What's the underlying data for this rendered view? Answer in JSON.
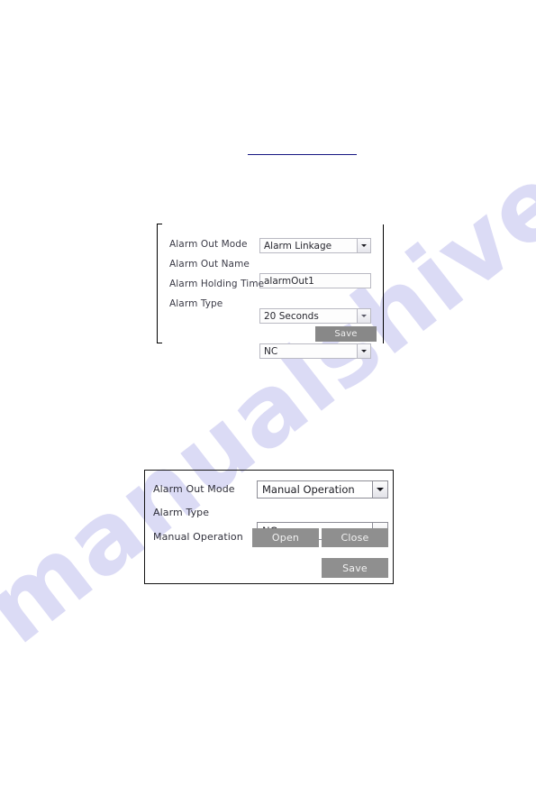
{
  "document": {
    "watermark_text": "manualshive.com",
    "watermark_color": "#c9c8f0",
    "background_color": "#ffffff",
    "rule_color": "#171782"
  },
  "panel_alarm_linkage": {
    "rows": [
      {
        "label": "Alarm Out Mode",
        "value": "Alarm Linkage",
        "control": "select",
        "icon": "chevron-down-icon"
      },
      {
        "label": "Alarm Out Name",
        "value": "alarmOut1",
        "control": "text",
        "icon": ""
      },
      {
        "label": "Alarm Holding Time",
        "value": "20 Seconds",
        "control": "select",
        "icon": "chevron-down-icon"
      },
      {
        "label": "Alarm Type",
        "value": "NC",
        "control": "select",
        "icon": "chevron-down-icon"
      }
    ],
    "save_label": "Save"
  },
  "panel_manual_operation": {
    "rows": [
      {
        "label": "Alarm Out Mode",
        "value": "Manual Operation",
        "control": "select",
        "icon": "chevron-down-icon"
      },
      {
        "label": "Alarm Type",
        "value": "NC",
        "control": "select",
        "icon": "chevron-down-icon"
      },
      {
        "label": "Manual Operation",
        "value": "",
        "control": "buttons",
        "icon": ""
      }
    ],
    "open_label": "Open",
    "close_label": "Close",
    "save_label": "Save"
  }
}
